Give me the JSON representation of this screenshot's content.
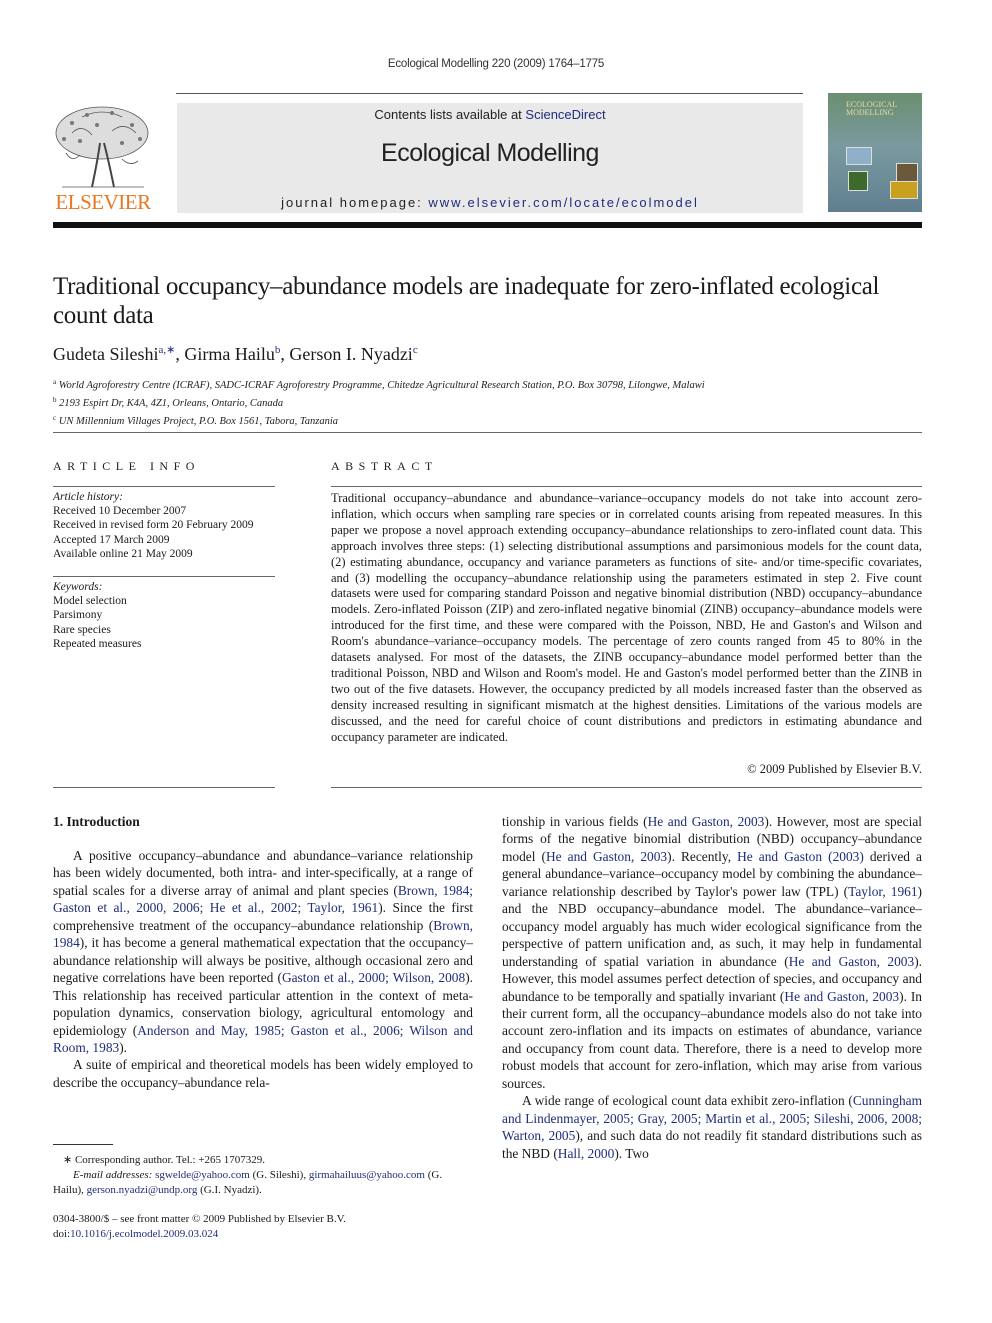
{
  "header": {
    "running_head": "Ecological Modelling 220 (2009) 1764–1775",
    "contents_prefix": "Contents lists available at ",
    "contents_link": "ScienceDirect",
    "journal_name": "Ecological Modelling",
    "homepage_prefix": "journal homepage: ",
    "homepage_url": "www.elsevier.com/locate/ecolmodel",
    "publisher_logo": "ELSEVIER",
    "cover_title_line1": "ECOLOGICAL",
    "cover_title_line2": "MODELLING",
    "colors": {
      "logo_orange": "#e87722",
      "link_blue": "#1f2d7a",
      "banner_gray": "#e9e9ea"
    }
  },
  "article": {
    "title": "Traditional occupancy–abundance models are inadequate for zero-inflated ecological count data",
    "authors": [
      {
        "name": "Gudeta Sileshi",
        "sup": "a,∗",
        "sep": ", "
      },
      {
        "name": "Girma Hailu",
        "sup": "b",
        "sep": ", "
      },
      {
        "name": "Gerson I. Nyadzi",
        "sup": "c",
        "sep": ""
      }
    ],
    "affiliations": [
      {
        "sup": "a",
        "text": "World Agroforestry Centre (ICRAF), SADC-ICRAF Agroforestry Programme, Chitedze Agricultural Research Station, P.O. Box 30798, Lilongwe, Malawi"
      },
      {
        "sup": "b",
        "text": "2193 Espirt Dr, K4A, 4Z1, Orleans, Ontario, Canada"
      },
      {
        "sup": "c",
        "text": "UN Millennium Villages Project, P.O. Box 1561, Tabora, Tanzania"
      }
    ]
  },
  "article_info": {
    "heading": "ARTICLE INFO",
    "history_label": "Article history:",
    "history": [
      "Received 10 December 2007",
      "Received in revised form 20 February 2009",
      "Accepted 17 March 2009",
      "Available online 21 May 2009"
    ],
    "keywords_label": "Keywords:",
    "keywords": [
      "Model selection",
      "Parsimony",
      "Rare species",
      "Repeated measures"
    ]
  },
  "abstract": {
    "heading": "ABSTRACT",
    "text": "Traditional occupancy–abundance and abundance–variance–occupancy models do not take into account zero-inflation, which occurs when sampling rare species or in correlated counts arising from repeated measures. In this paper we propose a novel approach extending occupancy–abundance relationships to zero-inflated count data. This approach involves three steps: (1) selecting distributional assumptions and parsimonious models for the count data, (2) estimating abundance, occupancy and variance parameters as functions of site- and/or time-specific covariates, and (3) modelling the occupancy–abundance relationship using the parameters estimated in step 2. Five count datasets were used for comparing standard Poisson and negative binomial distribution (NBD) occupancy–abundance models. Zero-inflated Poisson (ZIP) and zero-inflated negative binomial (ZINB) occupancy–abundance models were introduced for the first time, and these were compared with the Poisson, NBD, He and Gaston's and Wilson and Room's abundance–variance–occupancy models. The percentage of zero counts ranged from 45 to 80% in the datasets analysed. For most of the datasets, the ZINB occupancy–abundance model performed better than the traditional Poisson, NBD and Wilson and Room's model. He and Gaston's model performed better than the ZINB in two out of the five datasets. However, the occupancy predicted by all models increased faster than the observed as density increased resulting in significant mismatch at the highest densities. Limitations of the various models are discussed, and the need for careful choice of count distributions and predictors in estimating abundance and occupancy parameter are indicated.",
    "copyright": "© 2009 Published by Elsevier B.V."
  },
  "intro": {
    "heading": "1.  Introduction",
    "left_p1": [
      {
        "t": "A positive occupancy–abundance and abundance–variance relationship has been widely documented, both intra- and inter-specifically, at a range of spatial scales for a diverse array of animal and plant species ("
      },
      {
        "t": "Brown, 1984; Gaston et al., 2000, 2006; He et al., 2002; Taylor, 1961",
        "link": true
      },
      {
        "t": "). Since the first comprehensive treatment of the occupancy–abundance relationship ("
      },
      {
        "t": "Brown, 1984",
        "link": true
      },
      {
        "t": "), it has become a general mathematical expectation that the occupancy–abundance relationship will always be positive, although occasional zero and negative correlations have been reported ("
      },
      {
        "t": "Gaston et al., 2000; Wilson, 2008",
        "link": true
      },
      {
        "t": "). This relationship has received particular attention in the context of meta-population dynamics, conservation biology, agricultural entomology and epidemiology ("
      },
      {
        "t": "Anderson and May, 1985; Gaston et al., 2006; Wilson and Room, 1983",
        "link": true
      },
      {
        "t": ")."
      }
    ],
    "left_p2": [
      {
        "t": "A suite of empirical and theoretical models has been widely employed to describe the occupancy–abundance rela-"
      }
    ],
    "right_p1": [
      {
        "t": "tionship in various fields ("
      },
      {
        "t": "He and Gaston, 2003",
        "link": true
      },
      {
        "t": "). However, most are special forms of the negative binomial distribution (NBD) occupancy–abundance model ("
      },
      {
        "t": "He and Gaston, 2003",
        "link": true
      },
      {
        "t": "). Recently, "
      },
      {
        "t": "He and Gaston (2003)",
        "link": true
      },
      {
        "t": " derived a general abundance–variance–occupancy model by combining the abundance–variance relationship described by Taylor's power law (TPL) ("
      },
      {
        "t": "Taylor, 1961",
        "link": true
      },
      {
        "t": ") and the NBD occupancy–abundance model. The abundance–variance–occupancy model arguably has much wider ecological significance from the perspective of pattern unification and, as such, it may help in fundamental understanding of spatial variation in abundance ("
      },
      {
        "t": "He and Gaston, 2003",
        "link": true
      },
      {
        "t": "). However, this model assumes perfect detection of species, and occupancy and abundance to be temporally and spatially invariant ("
      },
      {
        "t": "He and Gaston, 2003",
        "link": true
      },
      {
        "t": "). In their current form, all the occupancy–abundance models also do not take into account zero-inflation and its impacts on estimates of abundance, variance and occupancy from count data. Therefore, there is a need to develop more robust models that account for zero-inflation, which may arise from various sources."
      }
    ],
    "right_p2": [
      {
        "t": "A wide range of ecological count data exhibit zero-inflation ("
      },
      {
        "t": "Cunningham and Lindenmayer, 2005; Gray, 2005; Martin et al., 2005; Sileshi, 2006, 2008; Warton, 2005",
        "link": true
      },
      {
        "t": "), and such data do not readily fit standard distributions such as the NBD ("
      },
      {
        "t": "Hall, 2000",
        "link": true
      },
      {
        "t": "). Two"
      }
    ]
  },
  "footnote": {
    "star_text": "∗  Corresponding author. Tel.: +265 1707329.",
    "email_label": "E-mail addresses: ",
    "emails": [
      {
        "email": "sgwelde@yahoo.com",
        "who": " (G. Sileshi), "
      },
      {
        "email": "girmahailuus@yahoo.com",
        "who": " (G. Hailu), "
      },
      {
        "email": "gerson.nyadzi@undp.org",
        "who": " (G.I. Nyadzi)."
      }
    ]
  },
  "front_matter": {
    "issn_line": "0304-3800/$ – see front matter © 2009 Published by Elsevier B.V.",
    "doi_prefix": "doi:",
    "doi": "10.1016/j.ecolmodel.2009.03.024"
  }
}
